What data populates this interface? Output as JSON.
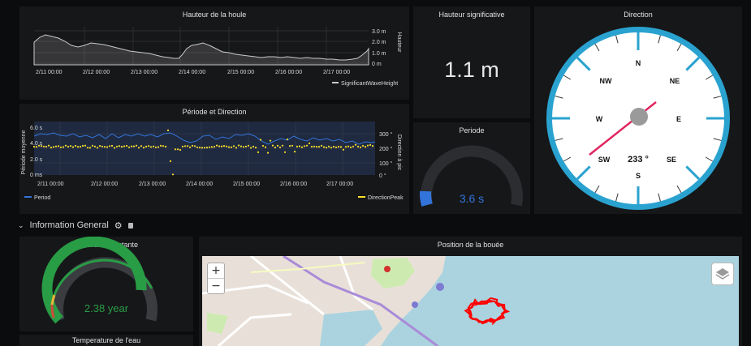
{
  "panels": {
    "wave_height": {
      "title": "Hauteur de la houle",
      "legend": "SignificantWaveHeight",
      "axis_label": "Hauteur",
      "y_ticks": [
        "3.0 m",
        "2.0 m",
        "1.0 m",
        "0 m"
      ],
      "x_ticks": [
        "2/11 00:00",
        "2/12 00:00",
        "2/13 00:00",
        "2/14 00:00",
        "2/15 00:00",
        "2/16 00:00",
        "2/17 00:00"
      ]
    },
    "sig_height": {
      "title": "Hauteur significative",
      "value": "1.1 m"
    },
    "direction": {
      "title": "Direction",
      "value": "233 °",
      "labels": {
        "n": "N",
        "ne": "NE",
        "e": "E",
        "se": "SE",
        "s": "S",
        "sw": "SW",
        "w": "W",
        "nw": "NW"
      }
    },
    "period_dir": {
      "title": "Période et Direction",
      "left_label": "Période moyenne",
      "right_label": "Direction à pic",
      "y_left_ticks": [
        "6.0 s",
        "4.0 s",
        "2.0 s",
        "0 ms"
      ],
      "y_right_ticks": [
        "300 °",
        "200 °",
        "100 °",
        "0 °"
      ],
      "x_ticks": [
        "2/11 00:00",
        "2/12 00:00",
        "2/13 00:00",
        "2/14 00:00",
        "2/15 00:00",
        "2/16 00:00",
        "2/17 00:00"
      ],
      "legend_left": "Period",
      "legend_right": "DirectionPeak"
    },
    "period": {
      "title": "Periode",
      "value": "3.6 s",
      "fraction": 0.05
    },
    "autonomy": {
      "title": "Autonomie restante",
      "value": "2.38 year",
      "fraction": 0.8
    },
    "water_temp": {
      "title": "Temperature de l'eau"
    },
    "buoy_position": {
      "title": "Position de la bouée",
      "zoom_in": "+",
      "zoom_out": "−"
    }
  },
  "row": {
    "title": "Information General",
    "gear": "gear-icon",
    "trash": "trash-icon"
  },
  "colors": {
    "wave": "#c9c9c9",
    "period": "#3274d9",
    "direction": "#fade2a",
    "gauge_green": "#299c46",
    "compass_ring": "#2aa2cf",
    "needle": "#e0245e",
    "track": "#ff0000"
  }
}
